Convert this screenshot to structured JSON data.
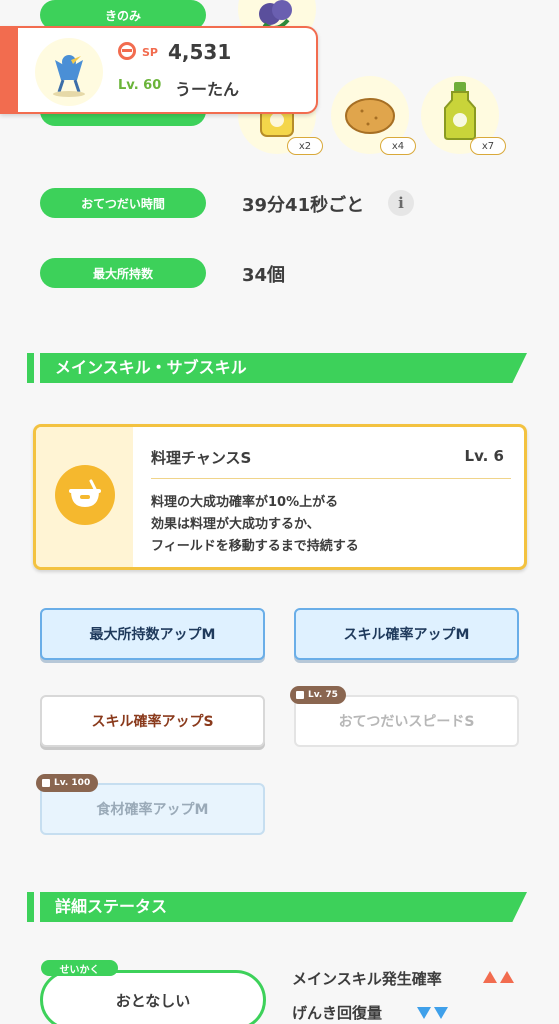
{
  "top": {
    "berry_label": "きのみ",
    "help_time_label": "おてつだい時間",
    "help_time_value": "39分41秒ごと",
    "max_carry_label": "最大所持数",
    "max_carry_value": "34個"
  },
  "profile": {
    "sp_label": "SP",
    "sp_value": "4,531",
    "level": "Lv. 60",
    "name": "うーたん"
  },
  "ingredients": [
    {
      "count": "x2",
      "icon": "honey-jar-icon"
    },
    {
      "count": "x4",
      "icon": "potato-icon"
    },
    {
      "count": "x7",
      "icon": "oil-bottle-icon"
    }
  ],
  "skills_section": {
    "title": "メインスキル・サブスキル",
    "main_skill": {
      "name": "料理チャンスS",
      "level": "Lv. 6",
      "desc1": "料理の大成功確率が10%上がる",
      "desc2": "効果は料理が大成功するか、",
      "desc3": "フィールドを移動するまで持続する"
    },
    "sub_skills": [
      {
        "label": "最大所持数アップM"
      },
      {
        "label": "スキル確率アップM"
      },
      {
        "label": "スキル確率アップS"
      },
      {
        "label": "おてつだいスピードS",
        "lock": "Lv. 75"
      },
      {
        "label": "食材確率アップM",
        "lock": "Lv. 100"
      }
    ]
  },
  "details_section": {
    "title": "詳細ステータス",
    "nature_tag": "せいかく",
    "nature": "おとなしい",
    "stat_up": "メインスキル発生確率",
    "stat_down": "げんき回復量",
    "up_color": "#f26c4f",
    "down_color": "#3fa0ea"
  }
}
